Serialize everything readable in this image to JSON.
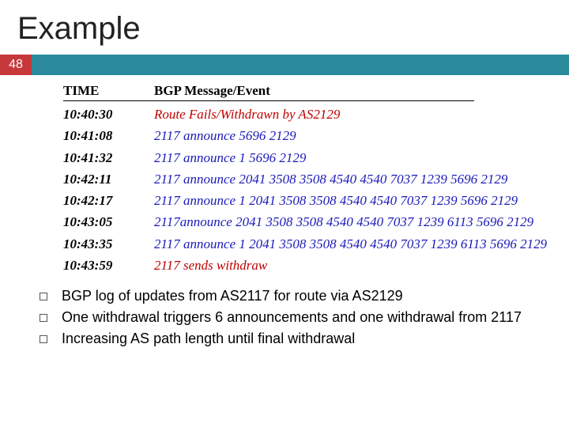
{
  "title": "Example",
  "page_number": "48",
  "log_header": {
    "time": "TIME",
    "event": "BGP Message/Event"
  },
  "log_rows": [
    {
      "time": "10:40:30",
      "event": "Route Fails/Withdrawn by AS2129",
      "red": true
    },
    {
      "time": "10:41:08",
      "event": "2117 announce 5696 2129",
      "red": false
    },
    {
      "time": "10:41:32",
      "event": "2117 announce 1 5696 2129",
      "red": false
    },
    {
      "time": "10:42:11",
      "event": "2117 announce 2041 3508 3508 4540 4540 7037 1239 5696 2129",
      "red": false
    },
    {
      "time": "10:42:17",
      "event": "2117 announce 1 2041 3508 3508 4540 4540 7037 1239 5696 2129",
      "red": false
    },
    {
      "time": "10:43:05",
      "event": "2117announce 2041 3508 3508 4540 4540 7037 1239 6113 5696 2129",
      "red": false
    },
    {
      "time": "10:43:35",
      "event": "2117 announce 1 2041 3508 3508 4540 4540 7037 1239 6113 5696 2129",
      "red": false
    },
    {
      "time": "10:43:59",
      "event": "2117 sends withdraw",
      "red": true
    }
  ],
  "bullets": [
    "BGP log of updates from AS2117 for route via AS2129",
    "One withdrawal triggers 6 announcements and one withdrawal from 2117",
    "Increasing AS path length until final withdrawal"
  ]
}
